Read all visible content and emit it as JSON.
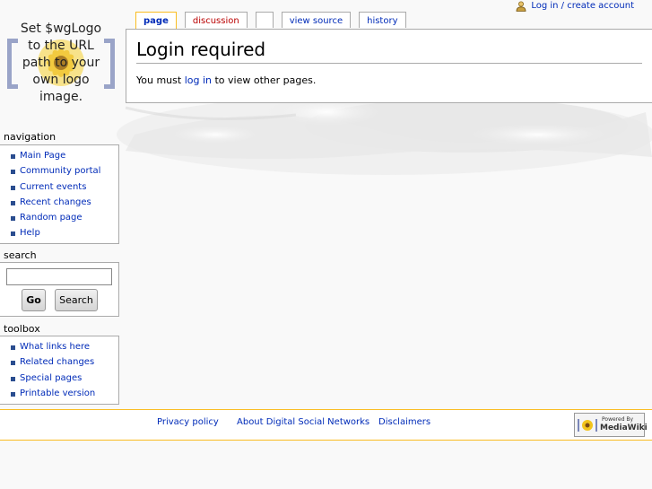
{
  "personal": {
    "login_label": "Log in / create account"
  },
  "logo": {
    "lines": [
      "Set $wgLogo",
      "to the URL",
      "path to your",
      "own logo",
      "image."
    ]
  },
  "tabs": [
    {
      "label": "page"
    },
    {
      "label": "discussion"
    },
    {
      "label": ""
    },
    {
      "label": "view source"
    },
    {
      "label": "history"
    }
  ],
  "content": {
    "title": "Login required",
    "body_before": "You must ",
    "body_link": "log in",
    "body_after": " to view other pages."
  },
  "navigation": {
    "title": "navigation",
    "items": [
      "Main Page",
      "Community portal",
      "Current events",
      "Recent changes",
      "Random page",
      "Help"
    ]
  },
  "search": {
    "title": "search",
    "value": "",
    "go_label": "Go",
    "search_label": "Search"
  },
  "toolbox": {
    "title": "toolbox",
    "items": [
      "What links here",
      "Related changes",
      "Special pages",
      "Printable version"
    ]
  },
  "footer": {
    "links": [
      "Privacy policy",
      "About Digital Social Networks",
      "Disclaimers"
    ],
    "powered_small": "Powered By",
    "powered_big": "MediaWiki"
  },
  "colors": {
    "link": "#002bb8",
    "new_link": "#ba0000",
    "accent_border": "#fabd23",
    "bullet": "#2a4d8f"
  },
  "icons": {
    "user": "user-icon",
    "mediawiki": "mediawiki-sunflower-icon"
  }
}
